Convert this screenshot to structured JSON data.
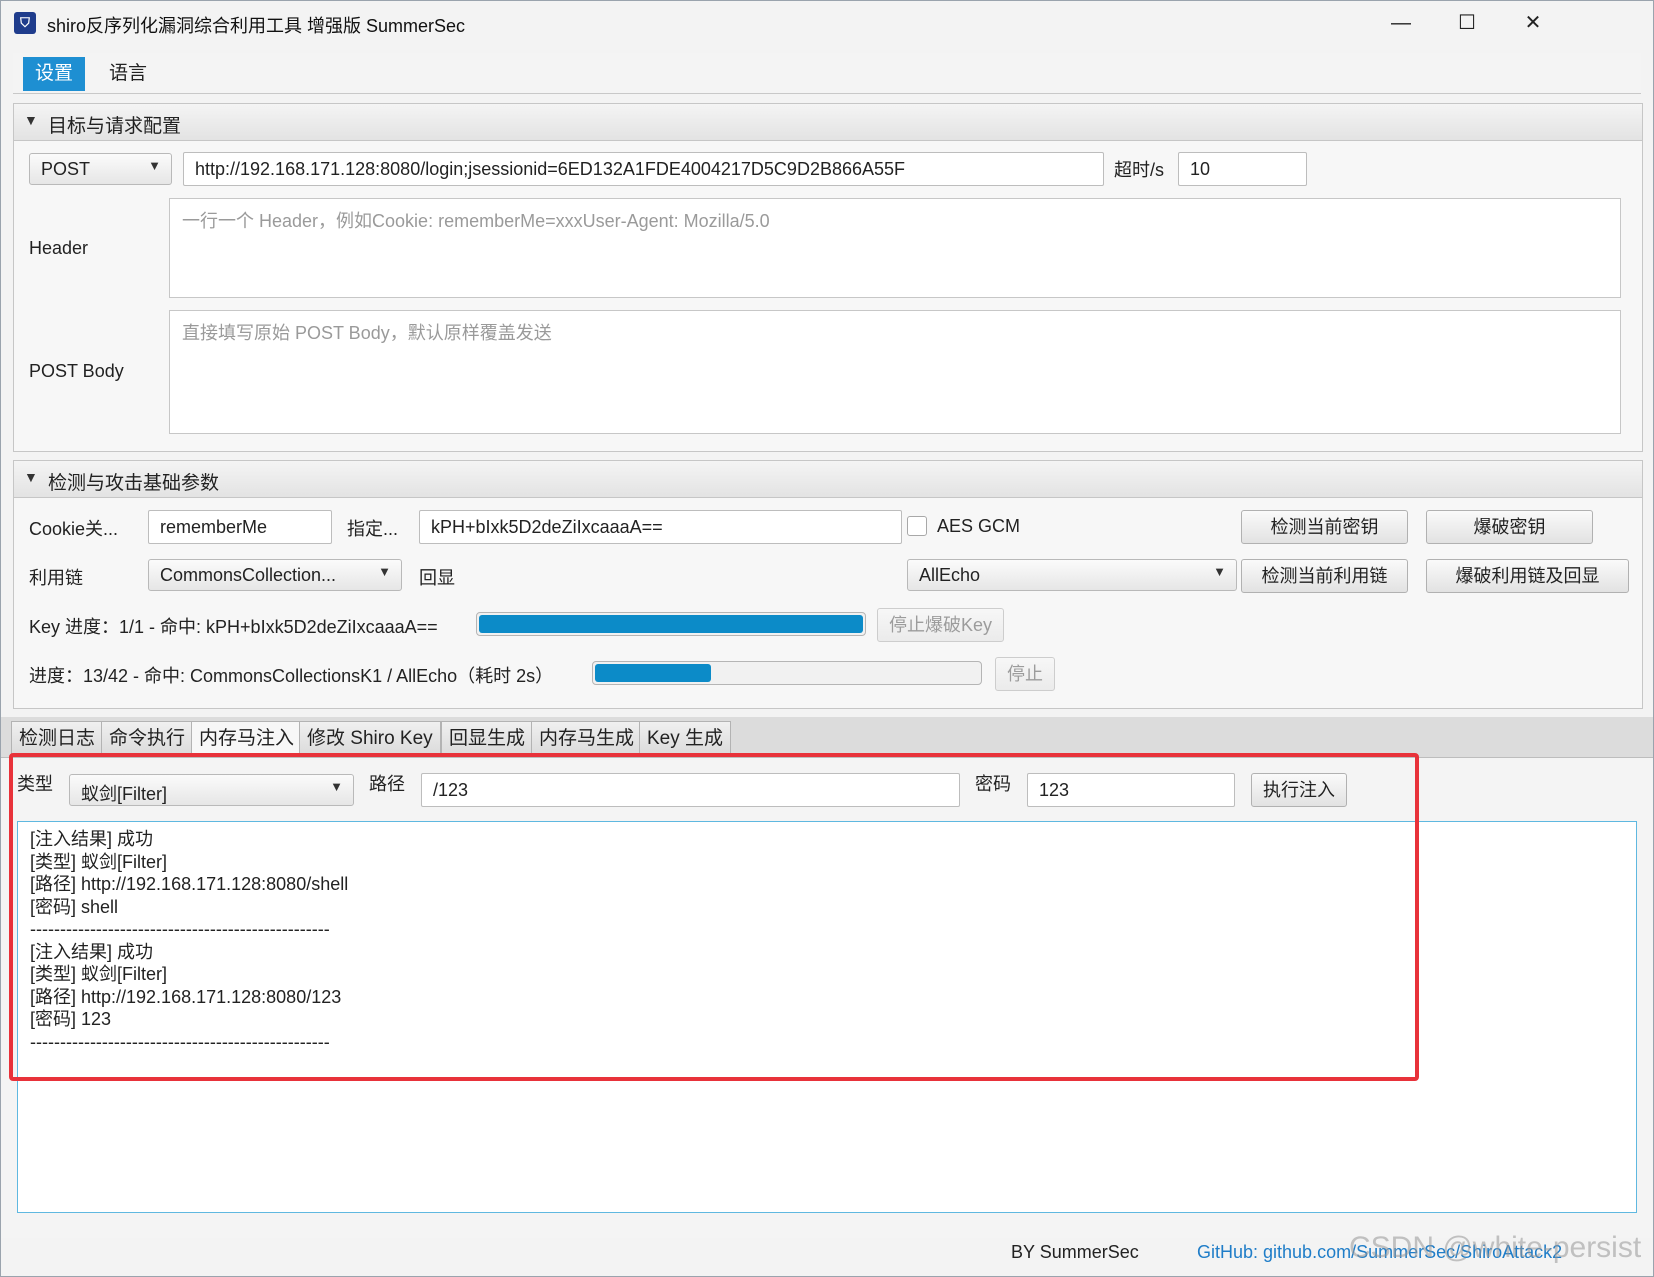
{
  "window": {
    "title": "shiro反序列化漏洞综合利用工具 增强版 SummerSec",
    "controls": {
      "minimize": "—",
      "maximize": "☐",
      "close": "✕"
    }
  },
  "menu": {
    "items": [
      "设置",
      "语言"
    ]
  },
  "target_section": {
    "title": "目标与请求配置",
    "method": "POST",
    "url": "http://192.168.171.128:8080/login;jsessionid=6ED132A1FDE4004217D5C9D2B866A55F",
    "timeout_label": "超时/s",
    "timeout_value": "10",
    "header_label": "Header",
    "header_placeholder": "一行一个 Header，例如Cookie: rememberMe=xxxUser-Agent: Mozilla/5.0",
    "body_label": "POST Body",
    "body_placeholder": "直接填写原始 POST Body，默认原样覆盖发送"
  },
  "attack_section": {
    "title": "检测与攻击基础参数",
    "cookie_label": "Cookie关...",
    "cookie_value": "rememberMe",
    "key_label": "指定...",
    "key_value": "kPH+bIxk5D2deZiIxcaaaA==",
    "aes_gcm_label": "AES GCM",
    "aes_gcm_checked": false,
    "btn_check_key": "检测当前密钥",
    "btn_brute_key": "爆破密钥",
    "chain_label": "利用链",
    "chain_value": "CommonsCollection...",
    "echo_label": "回显",
    "echo_value": "AllEcho",
    "btn_check_chain": "检测当前利用链",
    "btn_brute_chain": "爆破利用链及回显",
    "key_progress_text": "Key 进度：1/1 - 命中: kPH+bIxk5D2deZiIxcaaaA==",
    "key_progress_fraction": 1.0,
    "btn_stop_key": "停止爆破Key",
    "chain_progress_text": "进度：13/42 - 命中: CommonsCollectionsK1 / AllEcho（耗时 2s）",
    "chain_progress_fraction": 0.31,
    "btn_stop": "停止"
  },
  "tabs": [
    "检测日志",
    "命令执行",
    "内存马注入",
    "修改 Shiro Key",
    "回显生成",
    "内存马生成",
    "Key 生成"
  ],
  "inject_panel": {
    "type_label": "类型",
    "type_value": "蚁剑[Filter]",
    "path_label": "路径",
    "path_value": "/123",
    "password_label": "密码",
    "password_value": "123",
    "btn_inject": "执行注入",
    "output_lines": [
      "[注入结果] 成功",
      "[类型] 蚁剑[Filter]",
      "[路径] http://192.168.171.128:8080/shell",
      "[密码] shell",
      "--------------------------------------------------",
      "[注入结果] 成功",
      "[类型] 蚁剑[Filter]",
      "[路径] http://192.168.171.128:8080/123",
      "[密码] 123",
      "--------------------------------------------------"
    ]
  },
  "footer": {
    "by": "BY SummerSec",
    "github": "GitHub: github.com/SummerSec/ShiroAttack2"
  },
  "watermark": "CSDN @white-persist",
  "colors": {
    "accent": "#1e8fd2",
    "progress": "#0c8bc8",
    "highlight": "#e8323a",
    "link": "#1f7dc8"
  }
}
